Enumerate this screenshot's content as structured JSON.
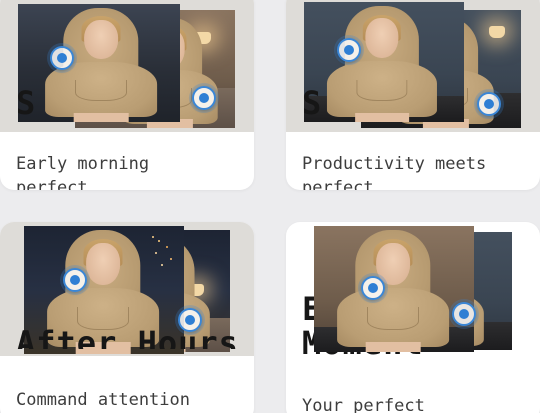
{
  "cards": [
    {
      "title": "S",
      "description": "Early morning\nperfect"
    },
    {
      "title": "S",
      "description": "Productivity meets\nperfect"
    },
    {
      "title": "After Hours",
      "description": "Command attention"
    },
    {
      "title": "E\nMoment",
      "description": "Your perfect"
    }
  ],
  "colors": {
    "page_background": "#ececee",
    "card_background": "#ffffff",
    "hotspot_accent": "#2f7fd4",
    "title_text": "#161616",
    "description_text": "#3d3d3d"
  },
  "icons": {
    "hotspot": "target-dot-icon"
  }
}
